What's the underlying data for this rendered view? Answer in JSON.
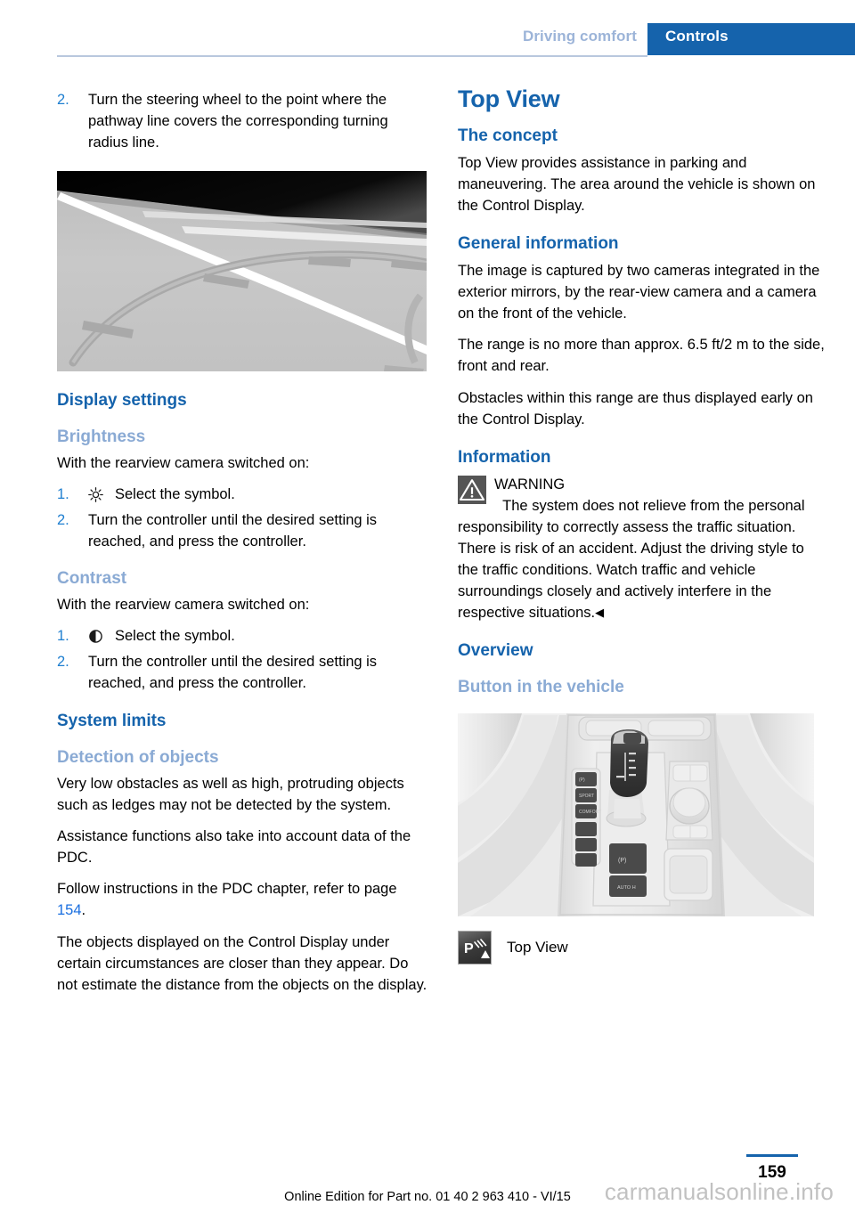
{
  "header": {
    "chapter": "Driving comfort",
    "section": "Controls"
  },
  "left_column": {
    "step_continued": {
      "number": "2.",
      "text": "Turn the steering wheel to the point where the pathway line covers the corresponding turning radius line."
    },
    "figure_rearview_alt": "Rearview camera display showing pathway lines and turning radius line",
    "display_settings": {
      "heading": "Display settings",
      "brightness": {
        "heading": "Brightness",
        "intro": "With the rearview camera switched on:",
        "steps": [
          {
            "number": "1.",
            "symbol": "brightness-sun-icon",
            "text": "Select the symbol."
          },
          {
            "number": "2.",
            "symbol": "",
            "text": "Turn the controller until the desired setting is reached, and press the controller."
          }
        ]
      },
      "contrast": {
        "heading": "Contrast",
        "intro": "With the rearview camera switched on:",
        "steps": [
          {
            "number": "1.",
            "symbol": "contrast-half-circle-icon",
            "text": "Select the symbol."
          },
          {
            "number": "2.",
            "symbol": "",
            "text": "Turn the controller until the desired setting is reached, and press the controller."
          }
        ]
      }
    },
    "system_limits": {
      "heading": "System limits",
      "detection": {
        "heading": "Detection of objects",
        "paragraphs": [
          "Very low obstacles as well as high, protruding objects such as ledges may not be detected by the system.",
          "Assistance functions also take into account data of the PDC."
        ],
        "pdc_ref_before": "Follow instructions in the PDC chapter, refer to page ",
        "pdc_ref_page": "154",
        "pdc_ref_after": ".",
        "closing_paragraph": "The objects displayed on the Control Display under certain circumstances are closer than they appear. Do not estimate the distance from the objects on the display."
      }
    }
  },
  "right_column": {
    "title": "Top View",
    "the_concept": {
      "heading": "The concept",
      "paragraph": "Top View provides assistance in parking and maneuvering. The area around the vehicle is shown on the Control Display."
    },
    "general_information": {
      "heading": "General information",
      "paragraphs": [
        "The image is captured by two cameras integrated in the exterior mirrors, by the rear-view camera and a camera on the front of the vehicle.",
        "The range is no more than approx. 6.5 ft/2 m to the side, front and rear.",
        "Obstacles within this range are thus displayed early on the Control Display."
      ]
    },
    "information": {
      "heading": "Information",
      "warning_label": "WARNING",
      "warning_icon": "warning-triangle-icon",
      "warning_text": "The system does not relieve from the personal responsibility to correctly assess the traffic situation. There is risk of an accident. Adjust the driving style to the traffic conditions. Watch traffic and vehicle surroundings closely and actively interfere in the respective situations.",
      "end_mark": "◀"
    },
    "overview": {
      "heading": "Overview",
      "subheading": "Button in the vehicle",
      "figure_console_alt": "Vehicle center console with gear selector, function buttons and iDrive controller",
      "caption": {
        "icon": "top-view-button-icon",
        "label": "Top View"
      }
    }
  },
  "footer": {
    "page_number": "159",
    "edition_note": "Online Edition for Part no. 01 40 2 963 410 - VI/15",
    "watermark": "carmanualsonline.info"
  }
}
